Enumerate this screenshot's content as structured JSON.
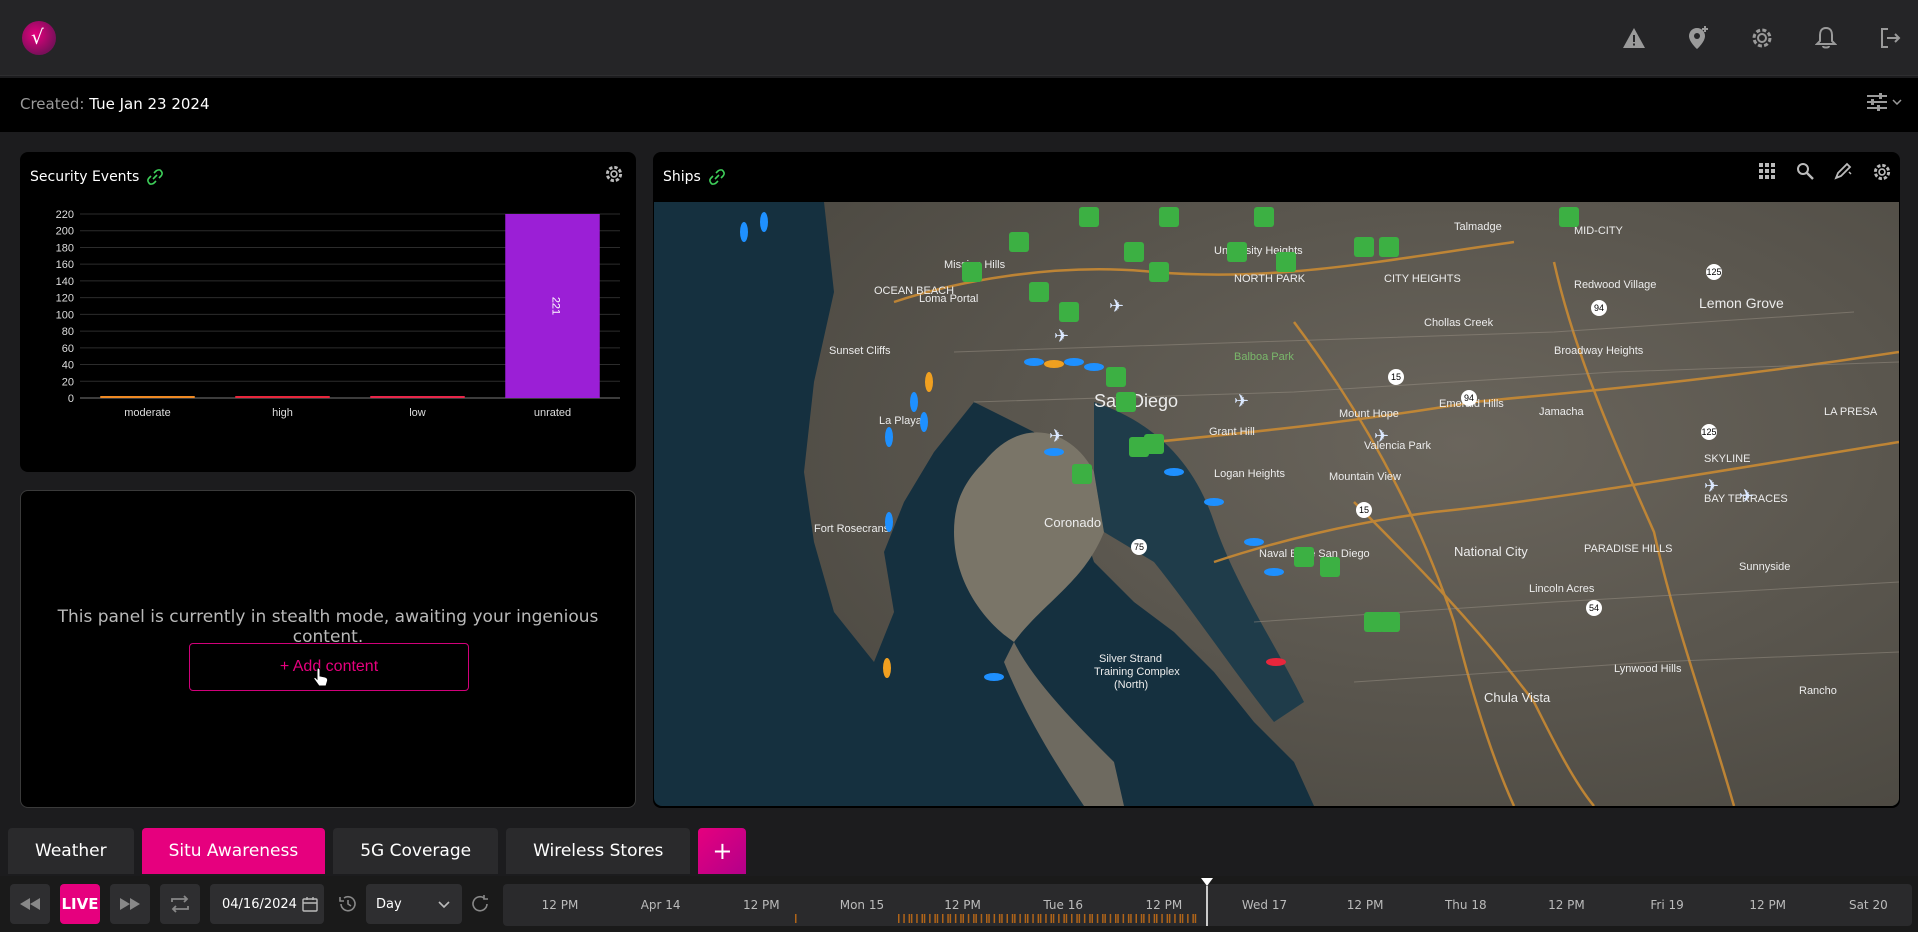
{
  "header": {
    "icons": [
      "alert-triangle-icon",
      "pin-add-icon",
      "gear-icon",
      "bell-icon",
      "logout-icon"
    ]
  },
  "created": {
    "label": "Created:",
    "value": "Tue Jan 23 2024"
  },
  "security_panel": {
    "title": "Security Events",
    "chart_data": {
      "type": "bar",
      "categories": [
        "moderate",
        "high",
        "low",
        "unrated"
      ],
      "values": [
        0,
        1,
        2,
        221
      ],
      "data_labels": [
        "",
        "",
        "",
        "221"
      ],
      "ylim": [
        0,
        220
      ],
      "yticks": [
        0,
        20,
        40,
        60,
        80,
        100,
        120,
        140,
        160,
        180,
        200,
        220
      ],
      "colors": [
        "#f08a24",
        "#e8263c",
        "#e8264a",
        "#9b1fd6"
      ],
      "grid": true
    }
  },
  "empty_panel": {
    "message": "This panel is currently in stealth mode, awaiting your ingenious content.",
    "add_label": "+ Add content"
  },
  "ships_panel": {
    "title": "Ships",
    "map_labels": [
      "Mission Hills",
      "University Heights",
      "NORTH PARK",
      "CITY HEIGHTS",
      "Talmadge",
      "MID-CITY",
      "Redwood Village",
      "Lemon Grove",
      "OCEAN BEACH",
      "Loma Portal",
      "Sunset Cliffs",
      "La Playa",
      "Balboa Park",
      "San Diego",
      "Grant Hill",
      "Logan Heights",
      "Mountain View",
      "Mount Hope",
      "Chollas Creek",
      "Broadway Heights",
      "Emerald Hills",
      "Valencia Park",
      "Jamacha",
      "LA PRESA",
      "SKYLINE",
      "Fort Rosecrans",
      "Coronado",
      "Naval Base San Diego",
      "National City",
      "PARADISE HILLS",
      "BAY TERRACES",
      "Lincoln Acres",
      "Sunnyside",
      "Silver Strand Training Complex (North)",
      "Lynwood Hills",
      "Chula Vista",
      "Rancho"
    ],
    "tools": [
      "grid-icon",
      "search-icon",
      "edit-icon",
      "gear-icon"
    ]
  },
  "tabs": [
    {
      "label": "Weather",
      "active": false
    },
    {
      "label": "Situ Awareness",
      "active": true
    },
    {
      "label": "5G Coverage",
      "active": false
    },
    {
      "label": "Wireless Stores",
      "active": false
    }
  ],
  "tab_add": "+",
  "timeline": {
    "live_label": "LIVE",
    "date": "04/16/2024",
    "range": "Day",
    "ticks": [
      "12 PM",
      "Apr 14",
      "12 PM",
      "Mon 15",
      "12 PM",
      "Tue 16",
      "12 PM",
      "Wed 17",
      "12 PM",
      "Thu 18",
      "12 PM",
      "Fri 19",
      "12 PM",
      "Sat 20"
    ]
  }
}
